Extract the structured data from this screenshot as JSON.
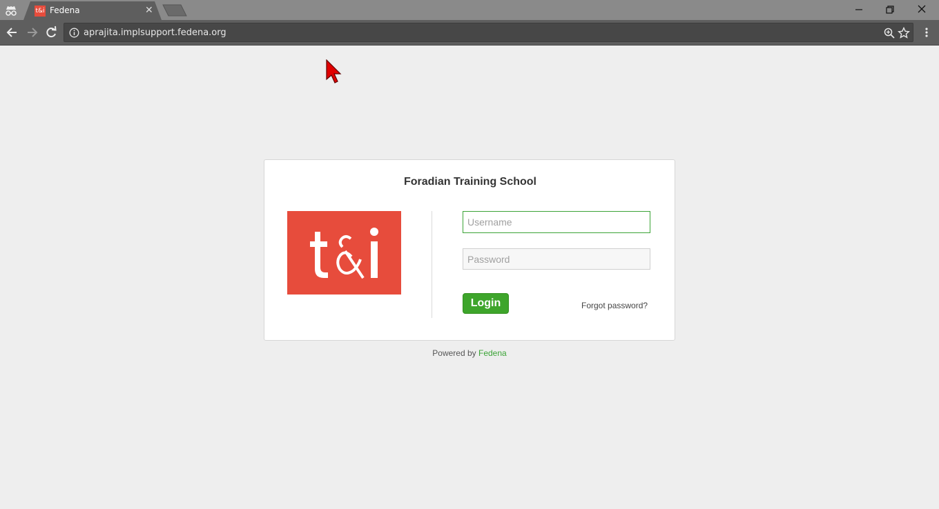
{
  "browser": {
    "tab": {
      "title": "Fedena",
      "favicon_text": "t&i",
      "close_symbol": "✕"
    },
    "address_bar": {
      "url": "aprajita.implsupport.fedena.org"
    },
    "icons": [
      "incognito-icon",
      "back-icon",
      "forward-icon",
      "reload-icon",
      "info-icon",
      "zoom-icon",
      "star-icon",
      "menu-icon",
      "minimize-icon",
      "restore-icon",
      "close-icon"
    ]
  },
  "login": {
    "school_name": "Foradian Training School",
    "logo_text": "t&i",
    "username": {
      "value": "",
      "placeholder": "Username"
    },
    "password": {
      "value": "",
      "placeholder": "Password"
    },
    "login_label": "Login",
    "forgot_label": "Forgot password?"
  },
  "footer": {
    "powered_text": "Powered by",
    "powered_link": "Fedena"
  },
  "colors": {
    "brand_red": "#e74c3c",
    "accent_green": "#3ea52b",
    "page_bg": "#eeeeee"
  }
}
